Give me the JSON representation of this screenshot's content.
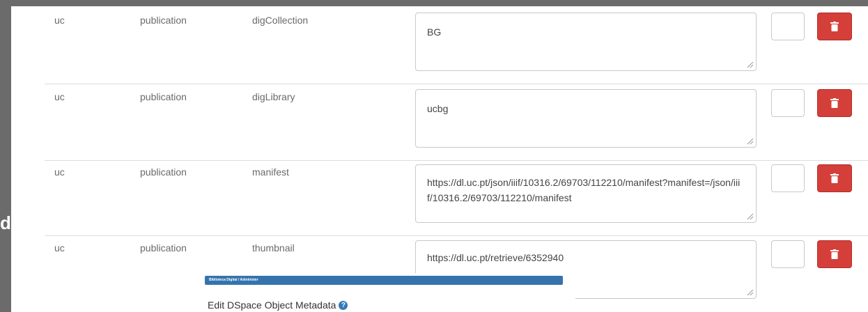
{
  "side_text": "d",
  "rows": [
    {
      "schema": "uc",
      "element": "publication",
      "qualifier": "digCollection",
      "value": "BG"
    },
    {
      "schema": "uc",
      "element": "publication",
      "qualifier": "digLibrary",
      "value": "ucbg"
    },
    {
      "schema": "uc",
      "element": "publication",
      "qualifier": "manifest",
      "value": "https://dl.uc.pt/json/iiif/10316.2/69703/112210/manifest?manifest=/json/iiif/10316.2/69703/112210/manifest"
    },
    {
      "schema": "uc",
      "element": "publication",
      "qualifier": "thumbnail",
      "value": "https://dl.uc.pt/retrieve/6352940"
    }
  ],
  "inset": {
    "breadcrumb": "Biblioteca Digital  /  Administer",
    "title": "Edit DSpace Object Metadata"
  },
  "icons": {
    "delete": "trash-icon",
    "help": "question-circle-icon",
    "resize": "resize-handle-icon"
  },
  "colors": {
    "delete_button": "#d43f3a",
    "breadcrumb_bar": "#3573ad",
    "help_icon": "#337ab7"
  }
}
